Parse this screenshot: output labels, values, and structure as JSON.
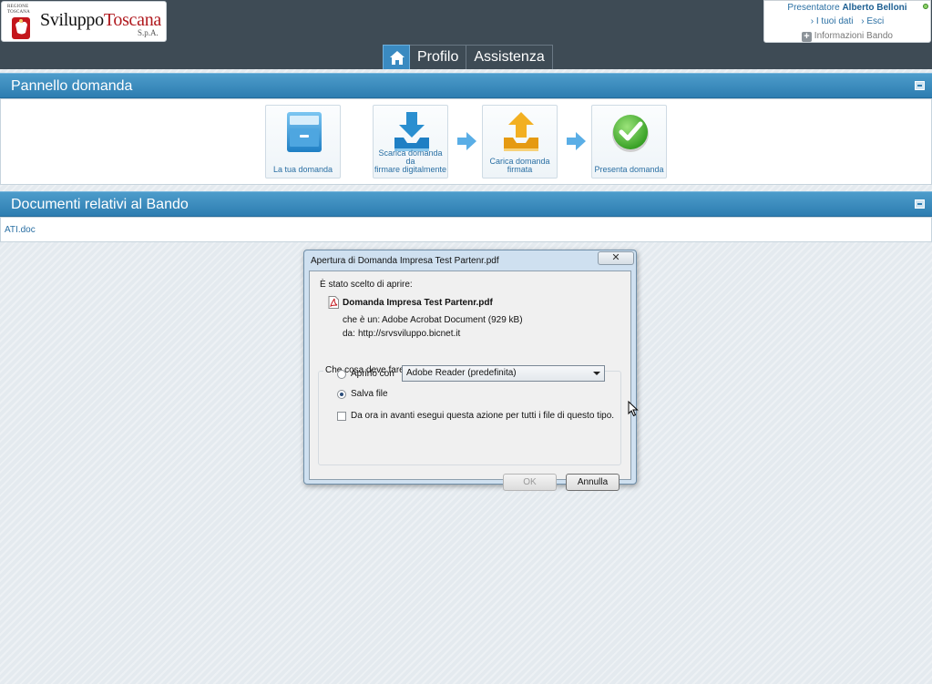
{
  "header": {
    "logo": {
      "region_text_1": "REGIONE",
      "region_text_2": "TOSCANA",
      "brand_part1": "Sviluppo",
      "brand_part2": "Toscana",
      "brand_suffix": "S.p.A."
    },
    "user": {
      "role_label": "Presentatore",
      "name": "Alberto Belloni",
      "link_my_data": "› I tuoi dati",
      "link_logout": "› Esci",
      "info_label": "Informazioni Bando"
    },
    "nav": {
      "home_icon": "home-icon",
      "items": [
        "Profilo",
        "Assistenza"
      ]
    }
  },
  "pannello": {
    "title": "Pannello domanda",
    "steps": [
      {
        "icon": "cabinet-icon",
        "label_line1": "La tua domanda",
        "label_line2": ""
      },
      {
        "icon": "download-icon",
        "label_line1": "Scarica domanda da",
        "label_line2": "firmare digitalmente"
      },
      {
        "icon": "upload-icon",
        "label_line1": "Carica domanda",
        "label_line2": "firmata"
      },
      {
        "icon": "checkmark-icon",
        "label_line1": "Presenta domanda",
        "label_line2": ""
      }
    ]
  },
  "documenti": {
    "title": "Documenti relativi al Bando",
    "files": [
      "ATI.doc"
    ]
  },
  "dialog": {
    "title": "Apertura di Domanda Impresa Test Partenr.pdf",
    "close_symbol": "✕",
    "intro": "È stato scelto di aprire:",
    "file_name": "Domanda Impresa Test Partenr.pdf",
    "type_label": "che è un:",
    "type_value": "Adobe Acrobat Document (929 kB)",
    "from_label": "da:",
    "from_value": "http://srvsviluppo.bicnet.it",
    "question": "Che cosa deve fare Firefox con questo file?",
    "open_with_label": "Aprirlo con",
    "open_with_value": "Adobe Reader  (predefinita)",
    "save_label": "Salva file",
    "selected_option": "save",
    "remember_label": "Da ora in avanti esegui questa azione per tutti i file di questo tipo.",
    "remember_checked": false,
    "ok_label": "OK",
    "cancel_label": "Annulla"
  },
  "colors": {
    "header_bg": "#3e4b55",
    "panel_header": "#2d7db1",
    "link": "#2a6fa3",
    "brand_red": "#b0191e"
  }
}
